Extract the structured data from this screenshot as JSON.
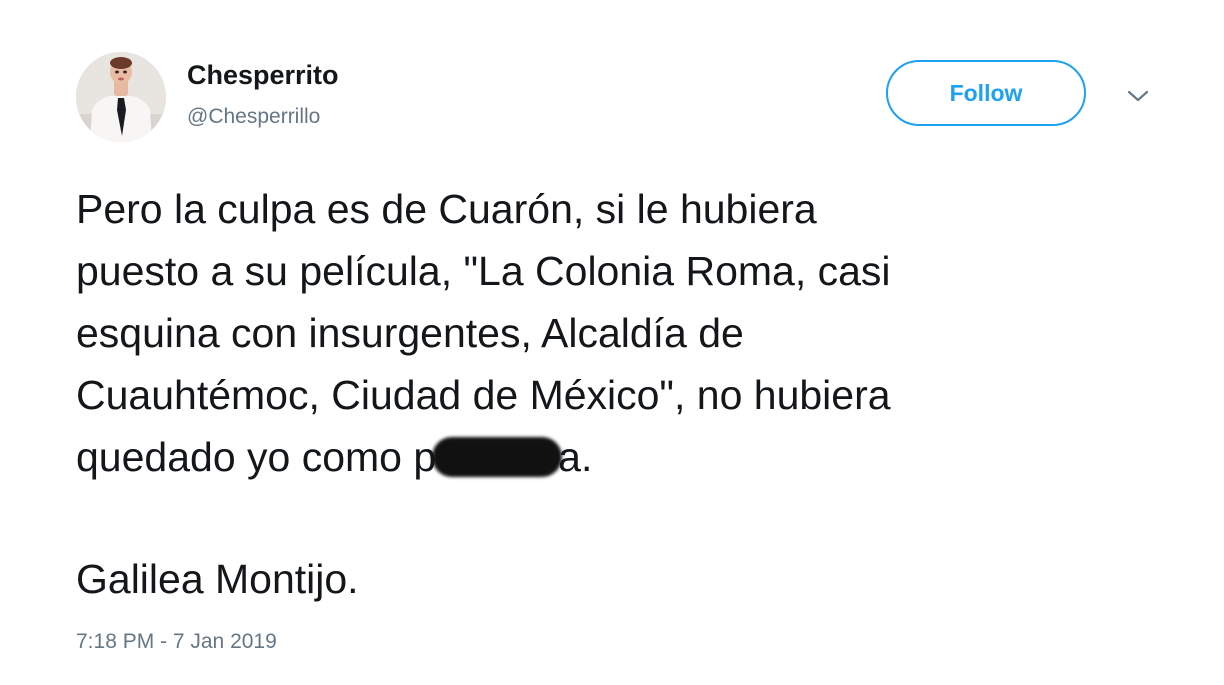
{
  "user": {
    "display_name": "Chesperrito",
    "handle": "@Chesperrillo",
    "avatar_icon": "profile-photo"
  },
  "actions": {
    "follow_label": "Follow",
    "more_icon": "chevron-down-icon",
    "accent_color": "#1da1f2"
  },
  "tweet": {
    "line1": "Pero la culpa es de Cuarón, si le hubiera",
    "line2": "puesto a su película, \"La Colonia Roma, casi",
    "line3": "esquina con insurgentes, Alcaldía de",
    "line4": "Cuauhtémoc, Ciudad de México\", no hubiera",
    "line5_before": "quedado yo como p",
    "line5_after": "a.",
    "signature": "Galilea Montijo."
  },
  "meta": {
    "timestamp": "7:18 PM - 7 Jan 2019"
  }
}
